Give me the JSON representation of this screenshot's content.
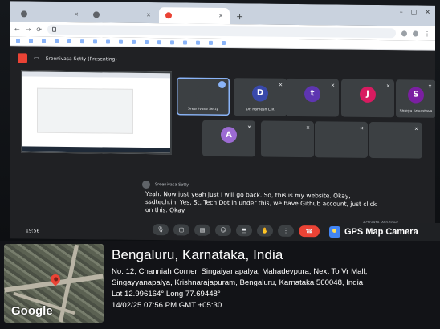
{
  "browser": {
    "tabs": [
      {
        "label": "",
        "active": false
      },
      {
        "label": "",
        "active": false
      },
      {
        "label": "",
        "active": true
      }
    ],
    "new_tab_glyph": "+",
    "window_controls": [
      "–",
      "□",
      "✕"
    ],
    "address": "",
    "bookmarks": [
      "",
      "",
      "",
      "",
      "",
      "",
      "",
      "",
      "",
      "",
      "",
      "",
      "",
      "",
      "",
      "",
      ""
    ]
  },
  "meet": {
    "presenting_title": "Sreenivasa Setty (Presenting)",
    "participants": [
      {
        "name": "Sreenivasa Setty",
        "initial": "",
        "color": "#3c4043",
        "speaking": true
      },
      {
        "name": "Dr. Ramesh C R",
        "initial": "D",
        "color": "#3949ab",
        "speaking": false
      },
      {
        "name": "",
        "initial": "t",
        "color": "#5e35b1",
        "speaking": false
      },
      {
        "name": "",
        "initial": "J",
        "color": "#d81b60",
        "speaking": false
      },
      {
        "name": "Shreya Srivastava",
        "initial": "S",
        "color": "#7b1fa2",
        "speaking": false
      },
      {
        "name": "",
        "initial": "A",
        "color": "#9c6bd3",
        "speaking": false
      },
      {
        "name": "",
        "initial": "",
        "color": "#3c4043",
        "speaking": false
      },
      {
        "name": "",
        "initial": "",
        "color": "#3c4043",
        "speaking": false
      },
      {
        "name": "",
        "initial": "",
        "color": "#3c4043",
        "speaking": false
      }
    ],
    "caption": {
      "speaker": "Sreenivasa Setty",
      "text": "Yeah. Now just yeah just I will go back. So, this is my website. Okay, ssdtech.in. Yes, St. Tech Dot in under this, we have Github account, just click on this. Okay."
    },
    "time": "19:56",
    "meeting_code": "",
    "activate_windows": "Activate Windows"
  },
  "stamp": {
    "badge": "GPS Map Camera",
    "title": "Bengaluru, Karnataka, India",
    "address_line1": "No. 12, Channiah Corner, Singaiyanapalya, Mahadevpura, Next To Vr Mall,",
    "address_line2": "Singayyanapalya, Krishnarajapuram, Bengaluru, Karnataka 560048, India",
    "coords": "Lat 12.996164° Long 77.69448°",
    "datetime": "14/02/25 07:56 PM GMT +05:30",
    "map_brand": "Google"
  }
}
